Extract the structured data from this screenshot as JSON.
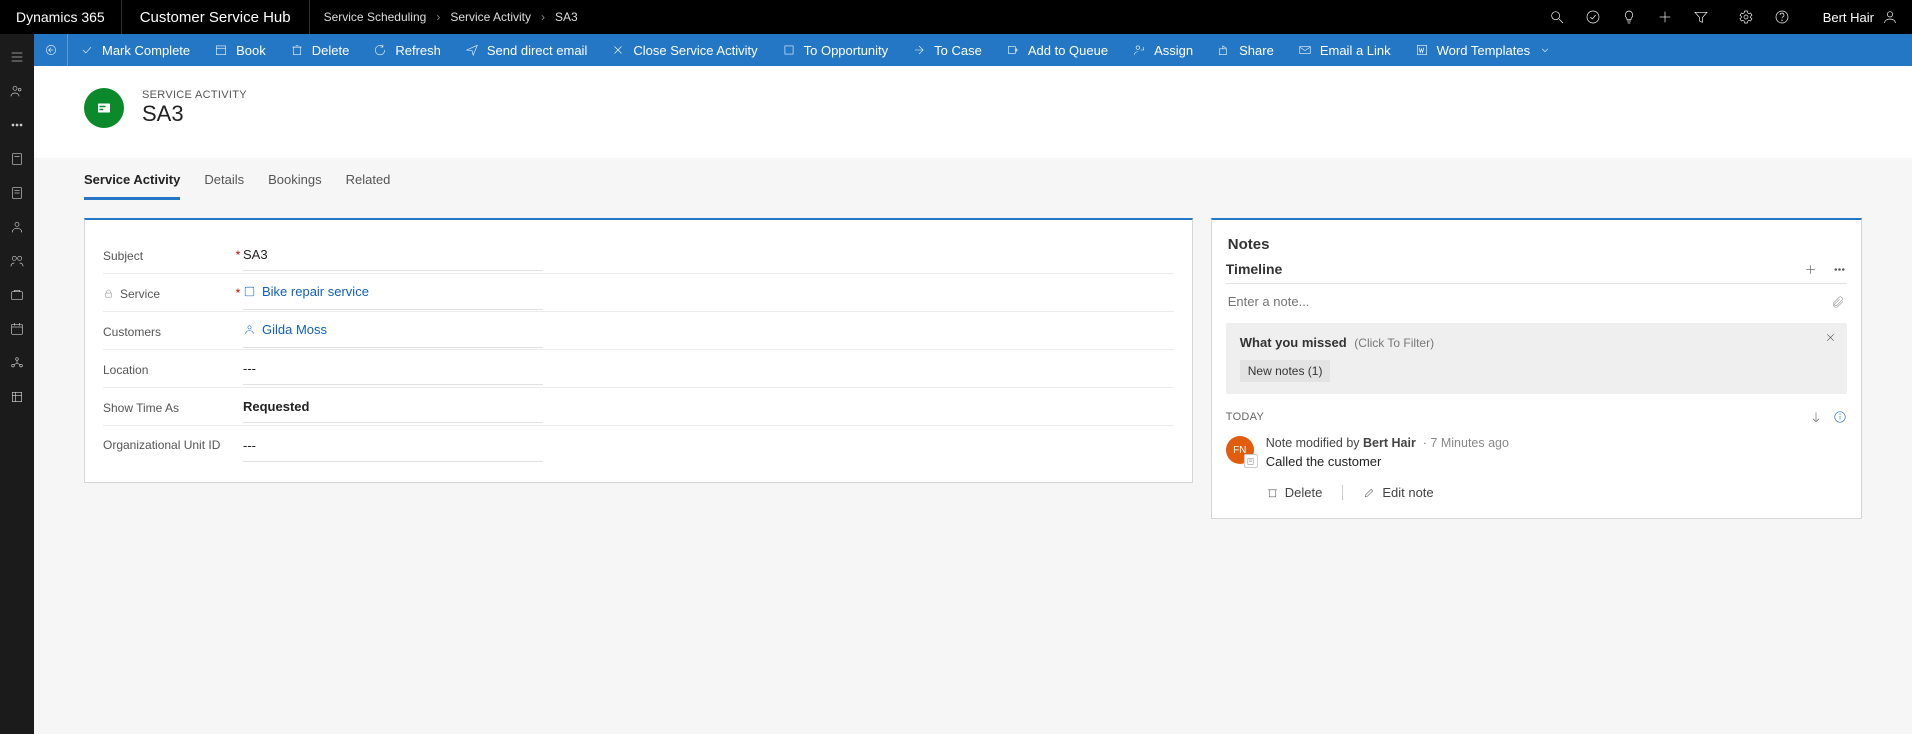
{
  "topbar": {
    "brand": "Dynamics 365",
    "app": "Customer Service Hub",
    "breadcrumb": [
      "Service Scheduling",
      "Service Activity",
      "SA3"
    ],
    "user": "Bert Hair"
  },
  "commands": {
    "mark_complete": "Mark Complete",
    "book": "Book",
    "delete": "Delete",
    "refresh": "Refresh",
    "send_direct_email": "Send direct email",
    "close_service_activity": "Close Service Activity",
    "to_opportunity": "To Opportunity",
    "to_case": "To Case",
    "add_to_queue": "Add to Queue",
    "assign": "Assign",
    "share": "Share",
    "email_a_link": "Email a Link",
    "word_templates": "Word Templates"
  },
  "record": {
    "entity_label": "SERVICE ACTIVITY",
    "title": "SA3"
  },
  "tabs": {
    "t0": "Service Activity",
    "t1": "Details",
    "t2": "Bookings",
    "t3": "Related"
  },
  "form": {
    "subject_label": "Subject",
    "subject_value": "SA3",
    "service_label": "Service",
    "service_value": "Bike repair service",
    "customers_label": "Customers",
    "customers_value": "Gilda Moss",
    "location_label": "Location",
    "location_value": "---",
    "showtimeas_label": "Show Time As",
    "showtimeas_value": "Requested",
    "orgunit_label": "Organizational Unit ID",
    "orgunit_value": "---"
  },
  "notes": {
    "section_title": "Notes",
    "timeline_label": "Timeline",
    "enter_placeholder": "Enter a note...",
    "missed_title": "What you missed",
    "missed_sub": "(Click To Filter)",
    "tag": "New notes (1)",
    "today_label": "TODAY",
    "note_prefix": "Note modified by ",
    "note_author": "Bert Hair",
    "note_time": "7 Minutes ago",
    "note_body": "Called the customer",
    "delete_label": "Delete",
    "edit_label": "Edit note",
    "avatar_initials": "FN"
  }
}
